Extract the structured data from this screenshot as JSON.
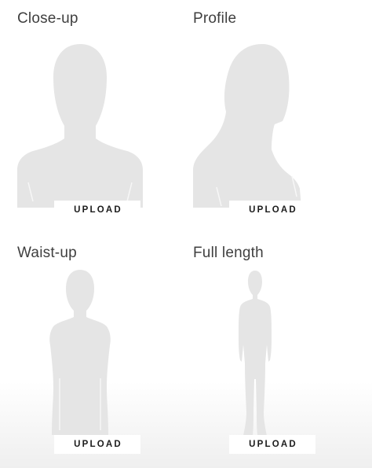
{
  "cards": [
    {
      "key": "close-up",
      "title": "Close-up",
      "icon": "head-and-shoulders-silhouette-icon",
      "upload_label": "UPLOAD"
    },
    {
      "key": "profile",
      "title": "Profile",
      "icon": "head-profile-silhouette-icon",
      "upload_label": "UPLOAD"
    },
    {
      "key": "waist-up",
      "title": "Waist-up",
      "icon": "waist-up-silhouette-icon",
      "upload_label": "UPLOAD"
    },
    {
      "key": "full-length",
      "title": "Full length",
      "icon": "full-body-silhouette-icon",
      "upload_label": "UPLOAD"
    }
  ],
  "colors": {
    "silhouette": "#e5e5e5",
    "title_text": "#3f3f3f",
    "button_text": "#1b1b1b",
    "background": "#ffffff"
  }
}
